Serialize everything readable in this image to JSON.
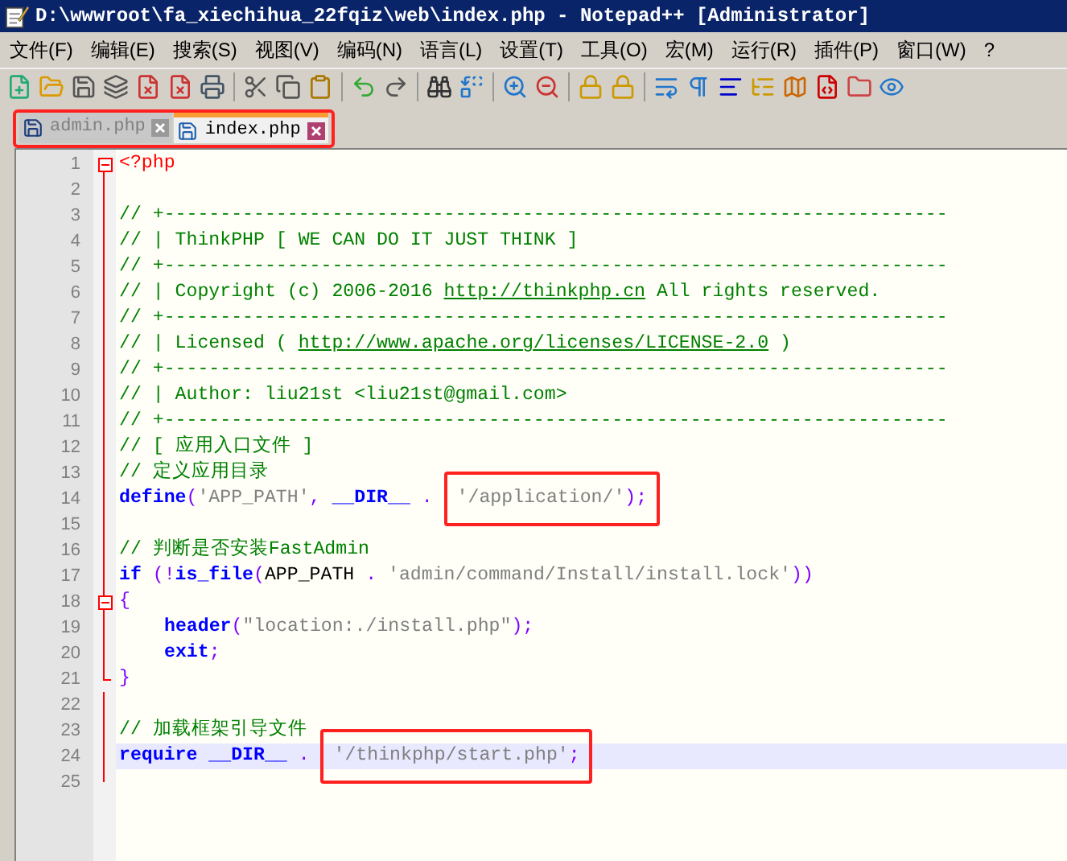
{
  "window": {
    "title": "D:\\wwwroot\\fa_xiechihua_22fqiz\\web\\index.php - Notepad++ [Administrator]"
  },
  "menu": [
    "文件(F)",
    "编辑(E)",
    "搜索(S)",
    "视图(V)",
    "编码(N)",
    "语言(L)",
    "设置(T)",
    "工具(O)",
    "宏(M)",
    "运行(R)",
    "插件(P)",
    "窗口(W)",
    "?"
  ],
  "tabs": {
    "boxed": true,
    "items": [
      {
        "label": "admin.php",
        "selected": false
      },
      {
        "label": "index.php",
        "selected": true
      }
    ]
  },
  "editor": {
    "lines": [
      {
        "number": "1",
        "kind": "fold_start",
        "current": false,
        "indented": false,
        "tokens": [
          {
            "t": "<?php",
            "kind": "php"
          }
        ]
      },
      {
        "number": "2",
        "kind": "code",
        "current": false
      },
      {
        "number": "3",
        "kind": "code",
        "current": false,
        "indented": false,
        "tokens": [
          {
            "t": "// +----------------------------------------------------------------------",
            "kind": "comment"
          }
        ]
      },
      {
        "number": "4",
        "kind": "code",
        "current": false,
        "indented": false,
        "tokens": [
          {
            "t": "// | ThinkPHP [ WE CAN DO IT JUST THINK ]",
            "kind": "comment"
          }
        ]
      },
      {
        "number": "5",
        "kind": "code",
        "current": false,
        "indented": false,
        "tokens": [
          {
            "t": "// +----------------------------------------------------------------------",
            "kind": "comment"
          }
        ]
      },
      {
        "number": "6",
        "kind": "code",
        "current": false,
        "indented": false,
        "tokens": [
          {
            "t": "// | Copyright (c) 2006-2016 ",
            "kind": "comment"
          },
          {
            "t": "http://thinkphp.cn",
            "kind": "link"
          },
          {
            "t": " All rights reserved.",
            "kind": "comment"
          }
        ]
      },
      {
        "number": "7",
        "kind": "code",
        "current": false,
        "indented": false,
        "tokens": [
          {
            "t": "// +----------------------------------------------------------------------",
            "kind": "comment"
          }
        ]
      },
      {
        "number": "8",
        "kind": "code",
        "current": false,
        "indented": false,
        "tokens": [
          {
            "t": "// | Licensed ( ",
            "kind": "comment"
          },
          {
            "t": "http://www.apache.org/licenses/LICENSE-2.0",
            "kind": "link"
          },
          {
            "t": " )",
            "kind": "comment"
          }
        ]
      },
      {
        "number": "9",
        "kind": "code",
        "current": false,
        "indented": false,
        "tokens": [
          {
            "t": "// +----------------------------------------------------------------------",
            "kind": "comment"
          }
        ]
      },
      {
        "number": "10",
        "kind": "code",
        "current": false,
        "indented": false,
        "tokens": [
          {
            "t": "// | Author: liu21st <liu21st@gmail.com>",
            "kind": "comment"
          }
        ]
      },
      {
        "number": "11",
        "kind": "code",
        "current": false,
        "indented": false,
        "tokens": [
          {
            "t": "// +----------------------------------------------------------------------",
            "kind": "comment"
          }
        ]
      },
      {
        "number": "12",
        "kind": "code",
        "current": false,
        "indented": false,
        "tokens": [
          {
            "t": "// [ 应用入口文件 ]",
            "kind": "comment"
          }
        ]
      },
      {
        "number": "13",
        "kind": "code",
        "current": false,
        "indented": false,
        "tokens": [
          {
            "t": "// 定义应用目录",
            "kind": "comment"
          }
        ]
      },
      {
        "number": "14",
        "kind": "code",
        "current": false,
        "indented": false,
        "tokens": [
          {
            "t": "define",
            "kind": "kw"
          },
          {
            "t": "(",
            "kind": "op"
          },
          {
            "t": "'APP_PATH'",
            "kind": "str"
          },
          {
            "t": ", ",
            "kind": "op"
          },
          {
            "t": "__DIR__",
            "kind": "kw"
          },
          {
            "t": " . ",
            "kind": "op"
          },
          {
            "t": "'/application/'",
            "kind": "str",
            "boxed": true
          },
          {
            "t": ");",
            "kind": "op",
            "boxed": true
          }
        ]
      },
      {
        "number": "15",
        "kind": "code",
        "current": false
      },
      {
        "number": "16",
        "kind": "code",
        "current": false,
        "indented": false,
        "tokens": [
          {
            "t": "// 判断是否安装FastAdmin",
            "kind": "comment"
          }
        ]
      },
      {
        "number": "17",
        "kind": "code",
        "current": false,
        "indented": false,
        "tokens": [
          {
            "t": "if",
            "kind": "kw"
          },
          {
            "t": " (!",
            "kind": "op"
          },
          {
            "t": "is_file",
            "kind": "kw"
          },
          {
            "t": "(",
            "kind": "op"
          },
          {
            "t": "APP_PATH",
            "kind": "plain"
          },
          {
            "t": " . ",
            "kind": "op"
          },
          {
            "t": "'admin/command/Install/install.lock'",
            "kind": "str"
          },
          {
            "t": "))",
            "kind": "op"
          }
        ]
      },
      {
        "number": "18",
        "kind": "fold_start",
        "current": false,
        "indented": false,
        "tokens": [
          {
            "t": "{",
            "kind": "op"
          }
        ]
      },
      {
        "number": "19",
        "kind": "code",
        "current": false,
        "indented": true,
        "tokens": [
          {
            "t": "header",
            "kind": "kw"
          },
          {
            "t": "(",
            "kind": "op"
          },
          {
            "t": "\"location:./install.php\"",
            "kind": "str"
          },
          {
            "t": ");",
            "kind": "op"
          }
        ]
      },
      {
        "number": "20",
        "kind": "code",
        "current": false,
        "indented": true,
        "tokens": [
          {
            "t": "exit",
            "kind": "kw"
          },
          {
            "t": ";",
            "kind": "op"
          }
        ]
      },
      {
        "number": "21",
        "kind": "fold_end",
        "current": false,
        "indented": false,
        "tokens": [
          {
            "t": "}",
            "kind": "op"
          }
        ]
      },
      {
        "number": "22",
        "kind": "code",
        "current": false
      },
      {
        "number": "23",
        "kind": "code",
        "current": false,
        "indented": false,
        "tokens": [
          {
            "t": "// 加载框架引导文件",
            "kind": "comment"
          }
        ]
      },
      {
        "number": "24",
        "kind": "code",
        "current": true,
        "indented": false,
        "tokens": [
          {
            "t": "require __DIR__",
            "kind": "kw"
          },
          {
            "t": " . ",
            "kind": "op"
          },
          {
            "t": "'/thinkphp/start.php'",
            "kind": "str",
            "boxed": true
          },
          {
            "t": ";",
            "kind": "op",
            "boxed": true
          }
        ]
      },
      {
        "number": "25",
        "kind": "code",
        "current": false
      }
    ]
  }
}
